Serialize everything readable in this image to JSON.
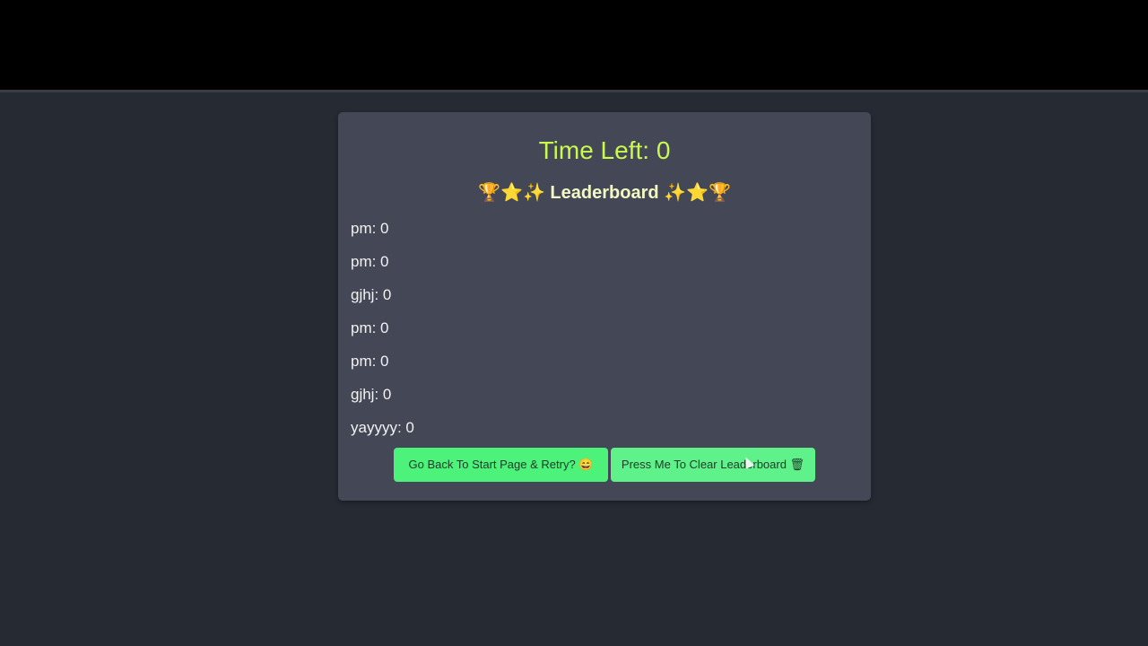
{
  "timer": {
    "label": "Time Left: 0"
  },
  "leaderboard": {
    "icons_left": "🏆⭐✨",
    "title": "Leaderboard",
    "icons_right": "✨⭐🏆",
    "entries": [
      "pm: 0",
      "pm: 0",
      "gjhj: 0",
      "pm: 0",
      "pm: 0",
      "gjhj: 0",
      "yayyyy: 0"
    ]
  },
  "buttons": {
    "retry_label": "Go Back To Start Page & Retry? 😄",
    "clear_label": "Press Me To Clear Leaderboard 🗑"
  },
  "colors": {
    "page_bg": "#262a33",
    "card_bg": "#434756",
    "timer_text": "#c9f94e",
    "heading_text": "#f3f8c4",
    "button_bg": "#4cf27a"
  }
}
